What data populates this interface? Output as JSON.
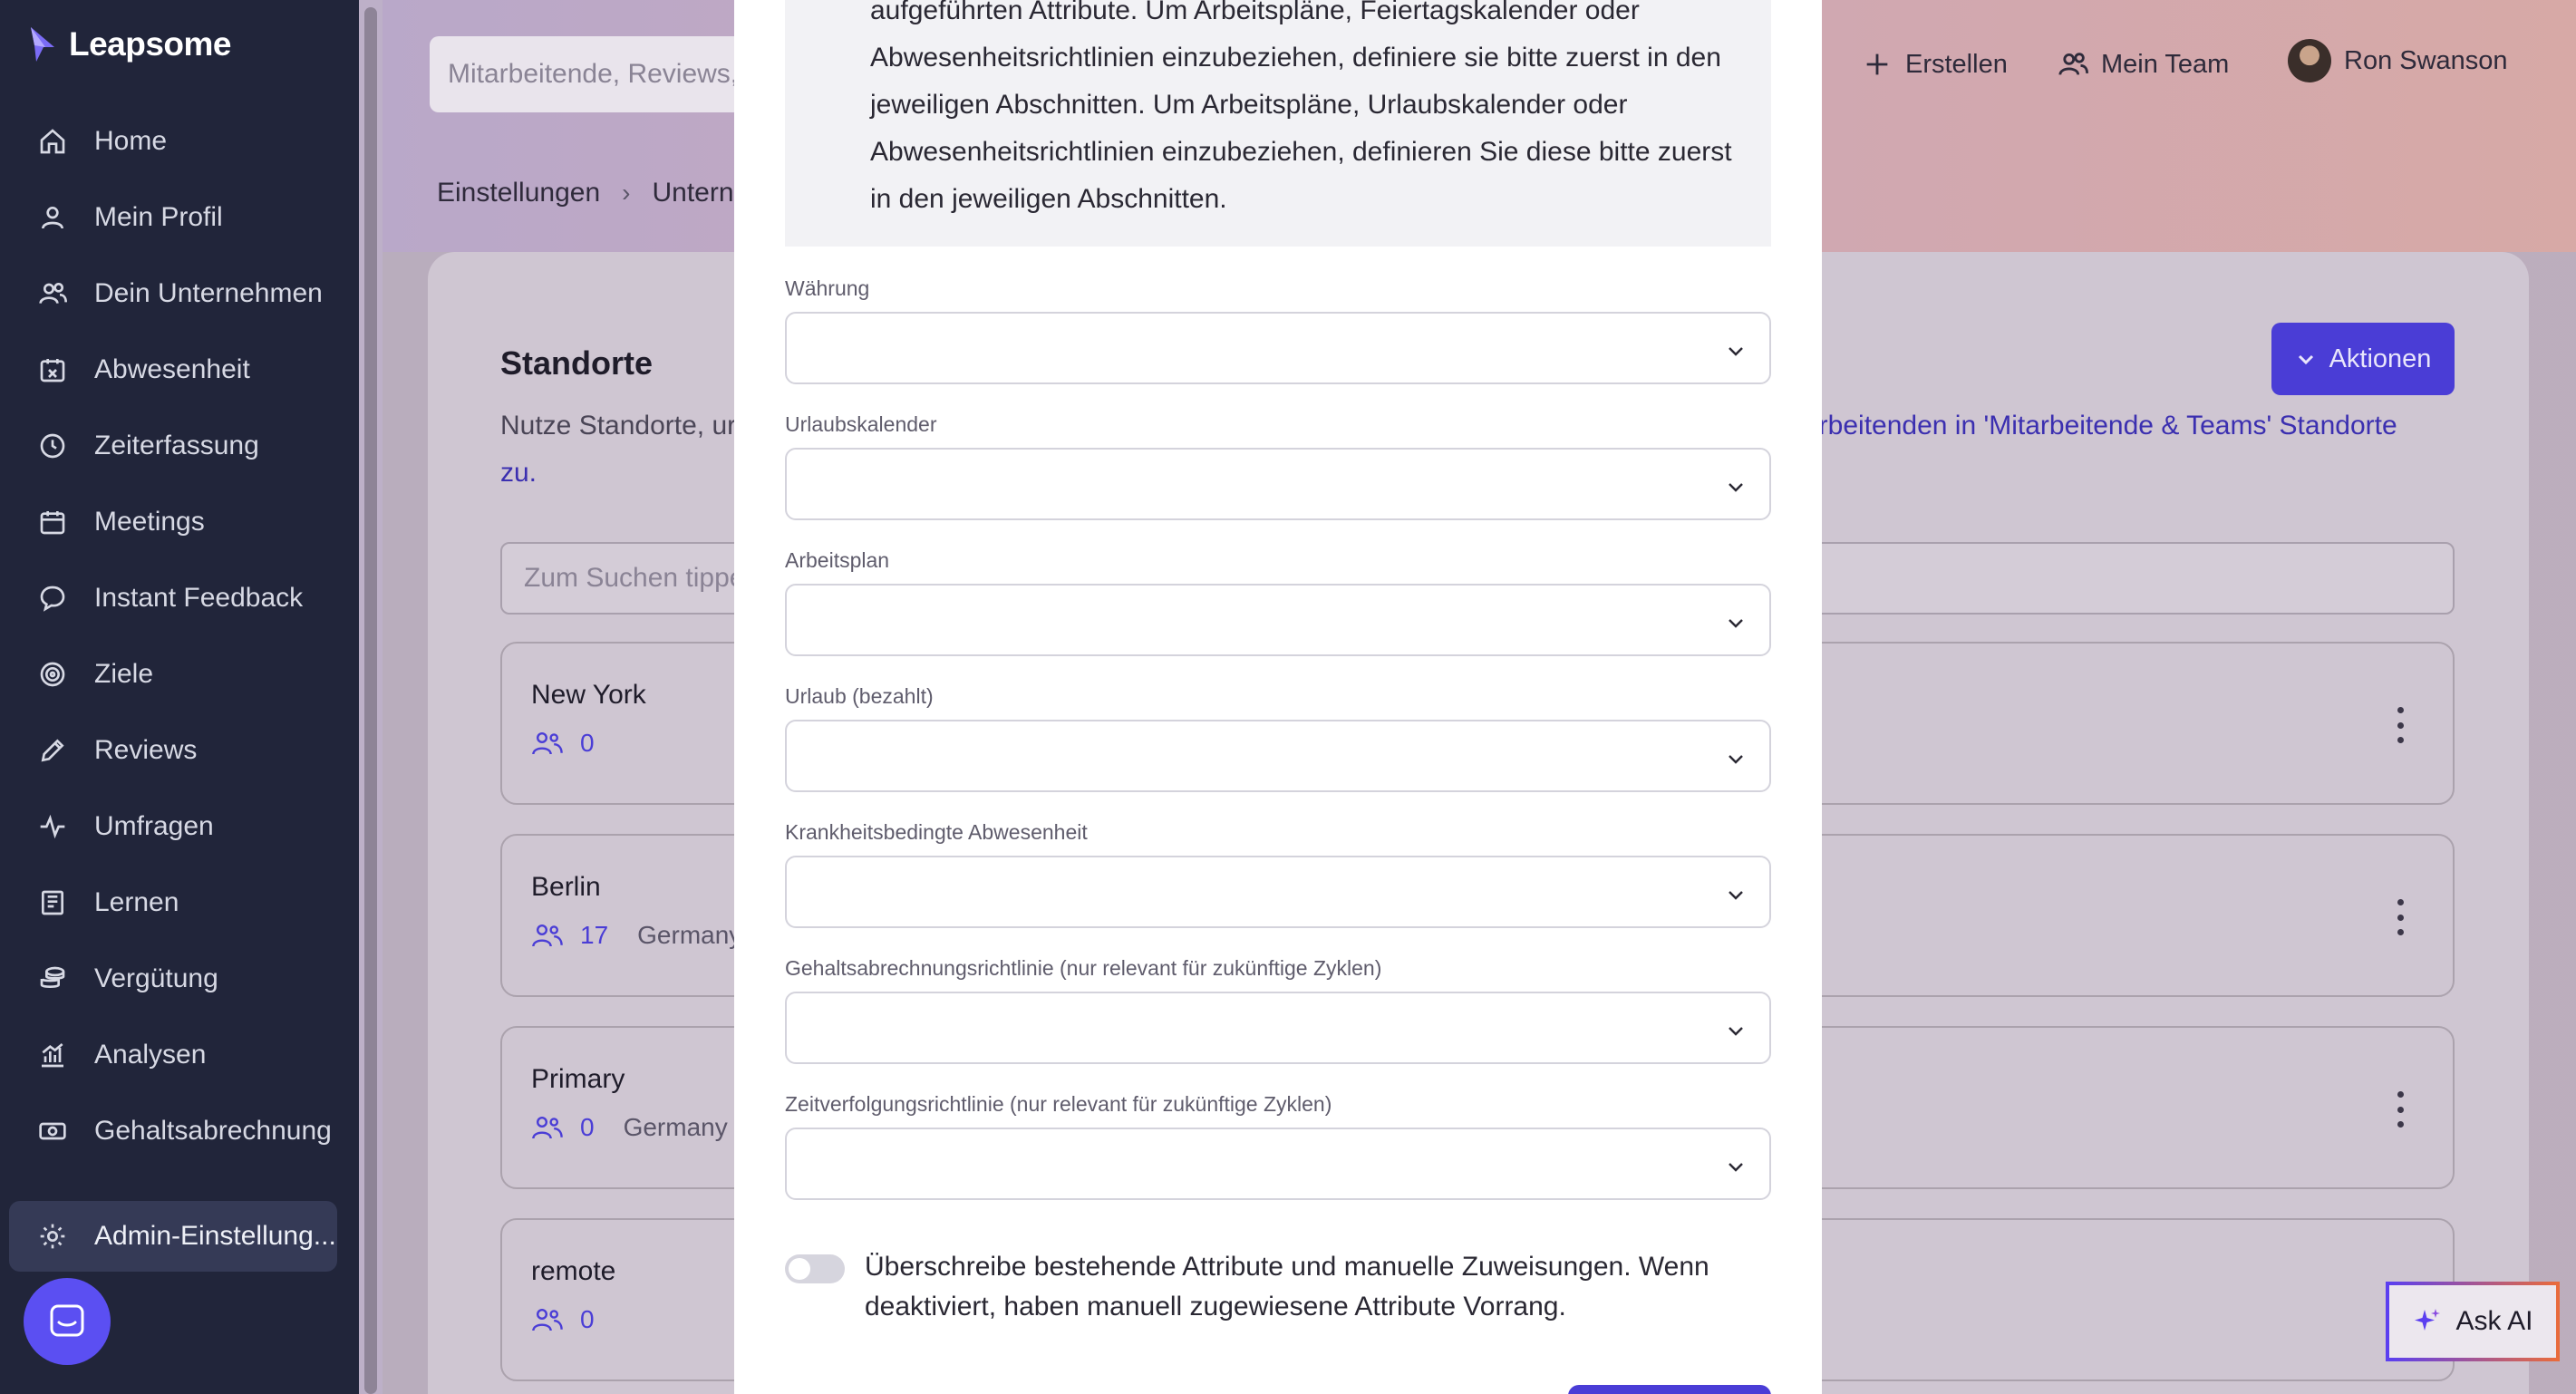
{
  "app": {
    "brand": "Leapsome"
  },
  "sidebar": {
    "items": [
      {
        "label": "Home",
        "icon": "home-icon"
      },
      {
        "label": "Mein Profil",
        "icon": "user-icon"
      },
      {
        "label": "Dein Unternehmen",
        "icon": "users-icon"
      },
      {
        "label": "Abwesenheit",
        "icon": "calendar-x-icon"
      },
      {
        "label": "Zeiterfassung",
        "icon": "clock-icon"
      },
      {
        "label": "Meetings",
        "icon": "calendar-icon"
      },
      {
        "label": "Instant Feedback",
        "icon": "chat-icon"
      },
      {
        "label": "Ziele",
        "icon": "target-icon"
      },
      {
        "label": "Reviews",
        "icon": "pencil-icon"
      },
      {
        "label": "Umfragen",
        "icon": "pulse-icon"
      },
      {
        "label": "Lernen",
        "icon": "book-icon"
      },
      {
        "label": "Vergütung",
        "icon": "coins-icon"
      },
      {
        "label": "Analysen",
        "icon": "chart-icon"
      },
      {
        "label": "Gehaltsabrechnung",
        "icon": "money-icon"
      },
      {
        "label": "Admin-Einstellung...",
        "icon": "gear-icon",
        "active": true
      }
    ]
  },
  "header": {
    "search_placeholder": "Mitarbeitende, Reviews,",
    "create_label": "Erstellen",
    "team_label": "Mein Team",
    "user_name": "Ron Swanson"
  },
  "breadcrumb": {
    "first": "Einstellungen",
    "second": "Unterne"
  },
  "page": {
    "title": "Standorte",
    "description_start": "Nutze Standorte, ur",
    "description_link": "arbeitenden in 'Mitarbeitende & Teams' Standorte",
    "description_end": "zu.",
    "actions_label": "Aktionen",
    "filter_placeholder": "Zum Suchen tippe"
  },
  "locations": [
    {
      "name": "New York",
      "count": "0",
      "country": ""
    },
    {
      "name": "Berlin",
      "count": "17",
      "country": "Germany"
    },
    {
      "name": "Primary",
      "count": "0",
      "country": "Germany"
    },
    {
      "name": "remote",
      "count": "0",
      "country": ""
    }
  ],
  "ask_ai_label": "Ask AI",
  "modal": {
    "notice": "aufgeführten Attribute. Um Arbeitspläne, Feiertagskalender oder Abwesenheitsrichtlinien einzubeziehen, definiere sie bitte zuerst in den jeweiligen Abschnitten. Um Arbeitspläne, Urlaubskalender oder Abwesenheitsrichtlinien einzubeziehen, definieren Sie diese bitte zuerst in den jeweiligen Abschnitten.",
    "fields": [
      {
        "label": "Währung",
        "value": ""
      },
      {
        "label": "Urlaubskalender",
        "value": ""
      },
      {
        "label": "Arbeitsplan",
        "value": ""
      },
      {
        "label": "Urlaub (bezahlt)",
        "value": ""
      },
      {
        "label": "Krankheitsbedingte Abwesenheit",
        "value": ""
      },
      {
        "label": "Gehaltsabrechnungsrichtlinie (nur relevant für zukünftige Zyklen)",
        "value": ""
      },
      {
        "label": "Zeitverfolgungsrichtlinie (nur relevant für zukünftige Zyklen)",
        "value": ""
      }
    ],
    "toggle_text": "Überschreibe bestehende Attribute und manuelle Zuweisungen. Wenn deaktiviert, haben manuell zugewiesene Attribute Vorrang.",
    "toggle_on": false
  },
  "colors": {
    "sidebar": "#21253a",
    "accent": "#4a3dd6",
    "chat": "#5b4ff2"
  }
}
